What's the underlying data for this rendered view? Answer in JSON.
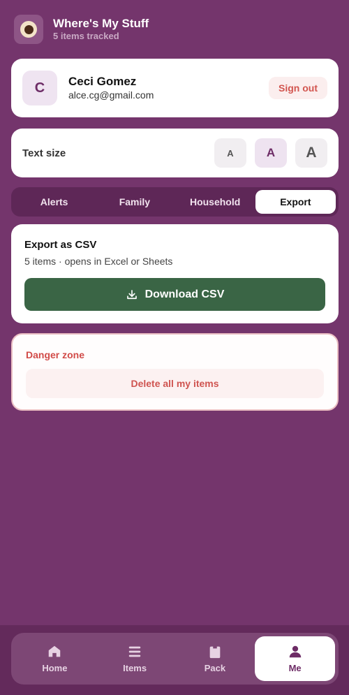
{
  "app": {
    "title": "Where's My Stuff",
    "subtitle": "5 items tracked"
  },
  "profile": {
    "initial": "C",
    "name": "Ceci Gomez",
    "email": "alce.cg@gmail.com",
    "signout_label": "Sign out"
  },
  "text_size": {
    "label": "Text size",
    "options": [
      "A",
      "A",
      "A"
    ],
    "selected": 1
  },
  "tabs": [
    {
      "label": "Alerts"
    },
    {
      "label": "Family"
    },
    {
      "label": "Household"
    },
    {
      "label": "Export"
    }
  ],
  "active_tab": 3,
  "export": {
    "title": "Export as CSV",
    "subtitle": "5 items · opens in Excel or Sheets",
    "download_label": "Download CSV"
  },
  "danger": {
    "title": "Danger zone",
    "delete_label": "Delete all my items"
  },
  "nav": [
    {
      "label": "Home",
      "icon": "home-icon"
    },
    {
      "label": "Items",
      "icon": "list-icon"
    },
    {
      "label": "Pack",
      "icon": "bag-icon"
    },
    {
      "label": "Me",
      "icon": "person-icon"
    }
  ],
  "active_nav": 3,
  "colors": {
    "background": "#74356c",
    "primary": "#3a6545",
    "danger": "#d14b48",
    "accent": "#6d2c66"
  }
}
